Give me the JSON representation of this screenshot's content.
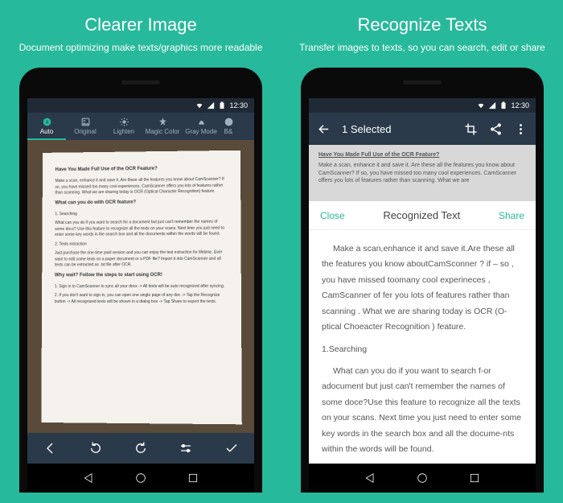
{
  "left": {
    "heading": "Clearer Image",
    "subheading": "Document optimizing make texts/graphics more readable",
    "statusbar": {
      "time": "12:30"
    },
    "modes": {
      "auto": "Auto",
      "original": "Original",
      "lighten": "Lighten",
      "magic": "Magic Color",
      "gray": "Gray Mode",
      "bw": "B&"
    },
    "paper": {
      "h1": "Have You Made Full Use of the OCR Feature?",
      "p1": "Make a scan, enhance it and save it. Are these all the features you know about CamScanner? If so, you have missed too many cool experiences. CamScanner offers you lots of features rather than scanning. What we are sharing today is OCR (Optical Character Recognition) feature.",
      "h2": "What can you do with OCR feature?",
      "s1": "1. Searching",
      "p2": "What can you do if you want to search for a document but just can't remember the names of some docs? Use this feature to recognize all the texts on your scans. Next time you just need to enter some key words in the search box and all the documents within the words will be found.",
      "p3": "2. Texts extraction",
      "p4": "Just purchase the one-time paid version and you can enjoy the text extraction for lifetime. Ever want to edit some texts on a paper document or a PDF file? Import it into CamScanner and all texts can be extracted as .txt file after OCR.",
      "h3": "Why wait? Follow the steps to start using OCR!",
      "p5": "1. Sign in to CamScanner to sync all your docs -> All texts will be auto recognized after syncing.",
      "p6": "2. If you don't want to sign in, you can open one single page of any doc -> Tap the Recognize button -> All recognized texts will be shown in a dialog box -> Tap Share to export the texts."
    }
  },
  "right": {
    "heading": "Recognize Texts",
    "subheading": "Transfer images to texts, so you can search, edit or share",
    "statusbar": {
      "time": "12:30"
    },
    "appbar": {
      "title": "1 Selected"
    },
    "preview": {
      "h": "Have You Made Full Use of the OCR Feature?",
      "p": "Make a scan, enhance it and save it. Are these all the features you know about CamScanner? If so, you have missed too many cool experiences. CamScanner offers you lots of features rather than scanning. What we are"
    },
    "sheet": {
      "close": "Close",
      "title": "Recognized Text",
      "share": "Share"
    },
    "body": {
      "p1": "Make a scan,enhance it and save it.Are these all the features you know aboutCamSconner ? if – so , you have missed toomany cool experineces , CamScanner of fer you lots of features rather than scanning . What we are sharing today is OCR (O-ptical Choeacter Recognition ) feature.",
      "s1": "1.Searching",
      "p2": "What can you do if you want to search f-or adocument but just can't remember the names of some doce?Use this feature to recognize all the texts on your scans. Next time you just need to enter some key words in the search box and all the docume-nts within the words will be found."
    }
  }
}
